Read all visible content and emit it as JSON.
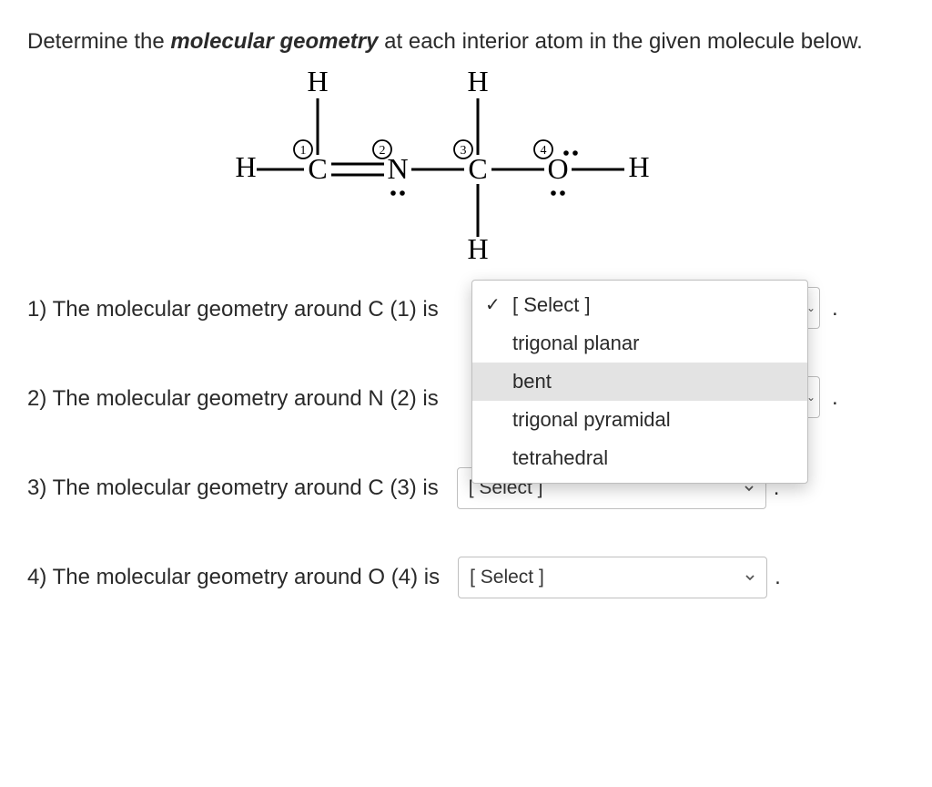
{
  "prompt": {
    "pre": "Determine the ",
    "emph": "molecular geometry",
    "post": " at each interior atom in the given molecule below."
  },
  "molecule": {
    "atoms": [
      "H",
      "H",
      "H",
      "C",
      "N",
      "C",
      "O",
      "H",
      "H"
    ],
    "labels": [
      "1",
      "2",
      "3",
      "4"
    ]
  },
  "questions": [
    {
      "text": "1) The molecular geometry around C (1) is"
    },
    {
      "text": "2) The molecular geometry around N (2) is"
    },
    {
      "text": "3) The molecular geometry around C (3) is"
    },
    {
      "text": "4) The molecular geometry around O (4) is"
    }
  ],
  "select_placeholder": "[ Select ]",
  "dropdown": {
    "options": [
      "[ Select ]",
      "trigonal planar",
      "bent",
      "trigonal pyramidal",
      "tetrahedral"
    ],
    "selected_index": 0,
    "hover_index": 2
  },
  "period": ".",
  "chart_data": {
    "type": "table",
    "description": "Lewis structure H–C(1)(H)=N(2)–C(3)(H)(H)–O(4)–H with lone pairs on N and O",
    "interior_atoms": [
      {
        "label": 1,
        "element": "C"
      },
      {
        "label": 2,
        "element": "N"
      },
      {
        "label": 3,
        "element": "C"
      },
      {
        "label": 4,
        "element": "O"
      }
    ],
    "geometry_options": [
      "trigonal planar",
      "bent",
      "trigonal pyramidal",
      "tetrahedral"
    ]
  }
}
